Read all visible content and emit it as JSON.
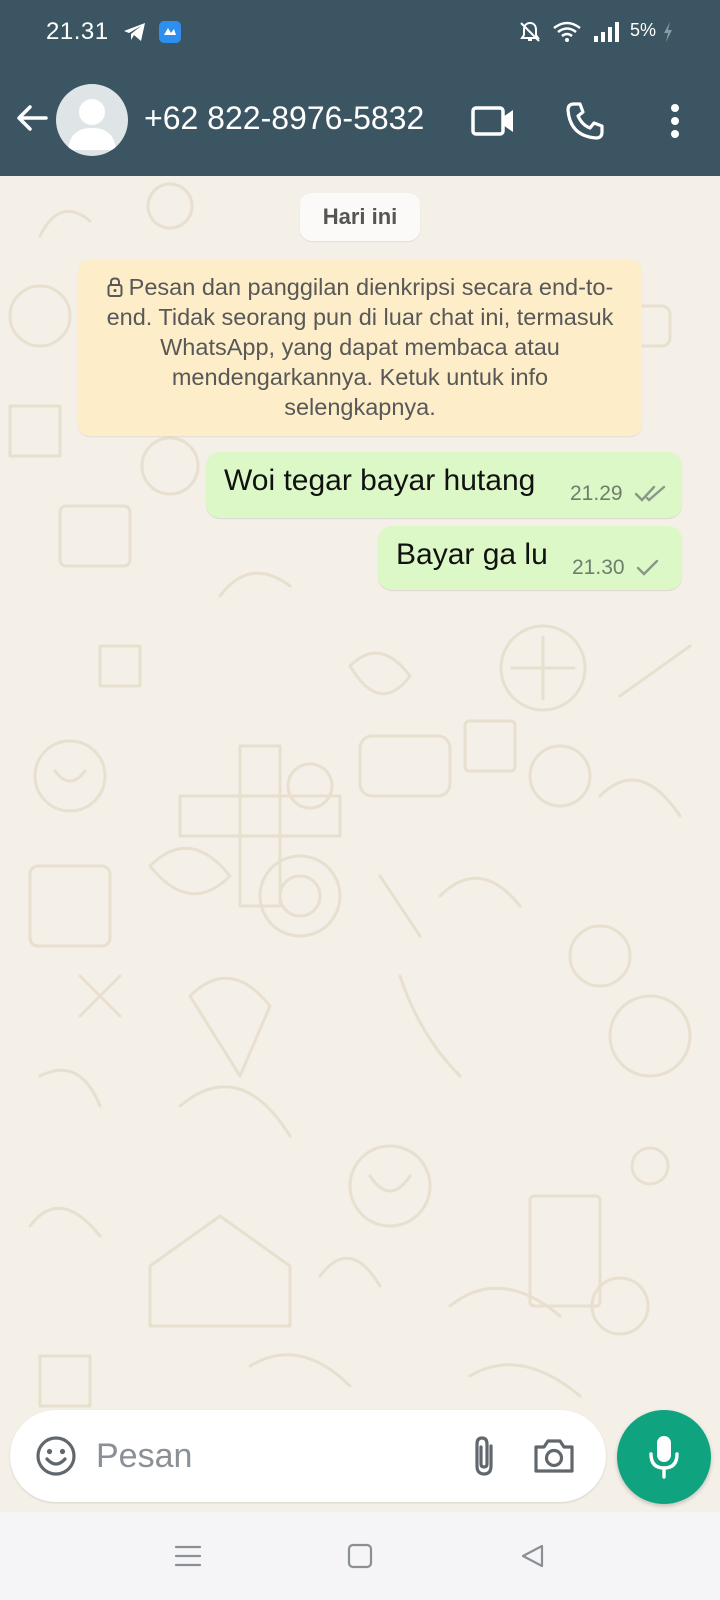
{
  "status_bar": {
    "time": "21.31",
    "battery": "5%",
    "icons": [
      "telegram-icon",
      "app-notification-icon",
      "mute-bell-icon",
      "wifi-icon",
      "signal-icon",
      "battery-charging-icon"
    ]
  },
  "header": {
    "contact_name": "+62 822-8976-5832",
    "icons": [
      "back-arrow-icon",
      "avatar-placeholder-icon",
      "video-call-icon",
      "phone-call-icon",
      "more-vert-icon"
    ],
    "color": "#3b5563"
  },
  "chat": {
    "date_chip": "Hari ini",
    "encryption_notice": "Pesan dan panggilan dienkripsi secara end-to-end. Tidak seorang pun di luar chat ini, termasuk WhatsApp, yang dapat membaca atau mendengarkannya. Ketuk untuk info selengkapnya.",
    "messages": [
      {
        "text": "Woi tegar bayar hutang",
        "time": "21.29",
        "status": "double-tick"
      },
      {
        "text": "Bayar ga lu",
        "time": "21.30",
        "status": "single-tick"
      }
    ],
    "bubble_color": "#dcf8c6"
  },
  "composer": {
    "placeholder": "Pesan",
    "icons": [
      "emoji-icon",
      "attach-icon",
      "camera-icon",
      "mic-icon"
    ],
    "mic_color": "#10a37f"
  },
  "navbar": {
    "icons": [
      "menu-icon",
      "home-icon",
      "back-icon"
    ]
  }
}
